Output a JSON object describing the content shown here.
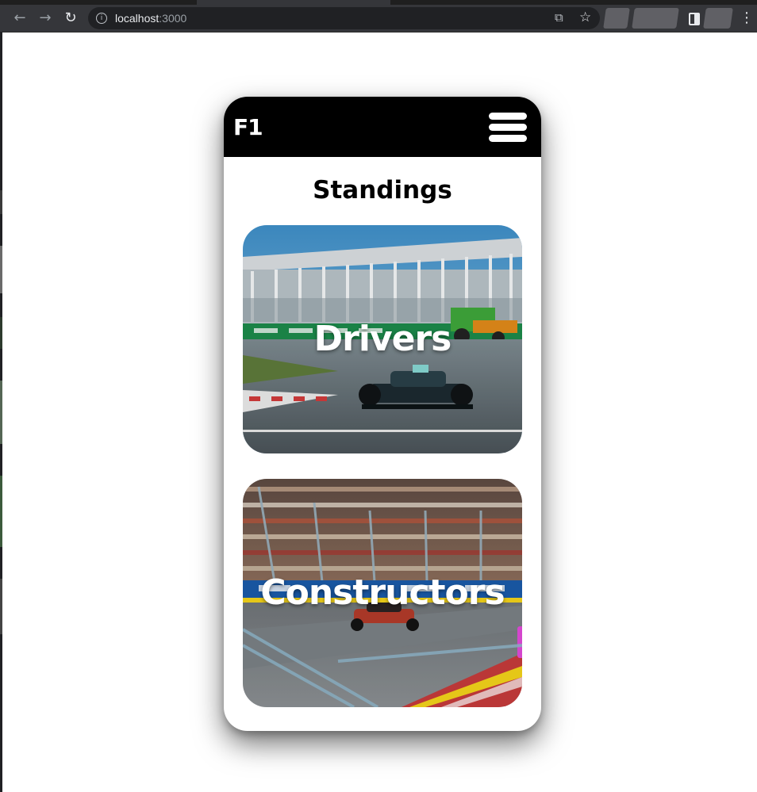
{
  "browser": {
    "url_host": "localhost",
    "url_port": ":3000"
  },
  "app": {
    "brand": "F1",
    "page_title": "Standings",
    "cards": [
      {
        "label": "Drivers"
      },
      {
        "label": "Constructors"
      }
    ]
  },
  "icons": {
    "back": "arrow-left",
    "forward": "arrow-right",
    "reload": "reload",
    "site_info": "info",
    "share": "share",
    "bookmark": "star",
    "side_panel": "side-panel",
    "browser_menu": "kebab",
    "app_menu": "hamburger"
  },
  "colors": {
    "chrome_toolbar": "#35363a",
    "omnibox": "#202124",
    "app_header": "#000000",
    "brand_text": "#ffffff"
  }
}
